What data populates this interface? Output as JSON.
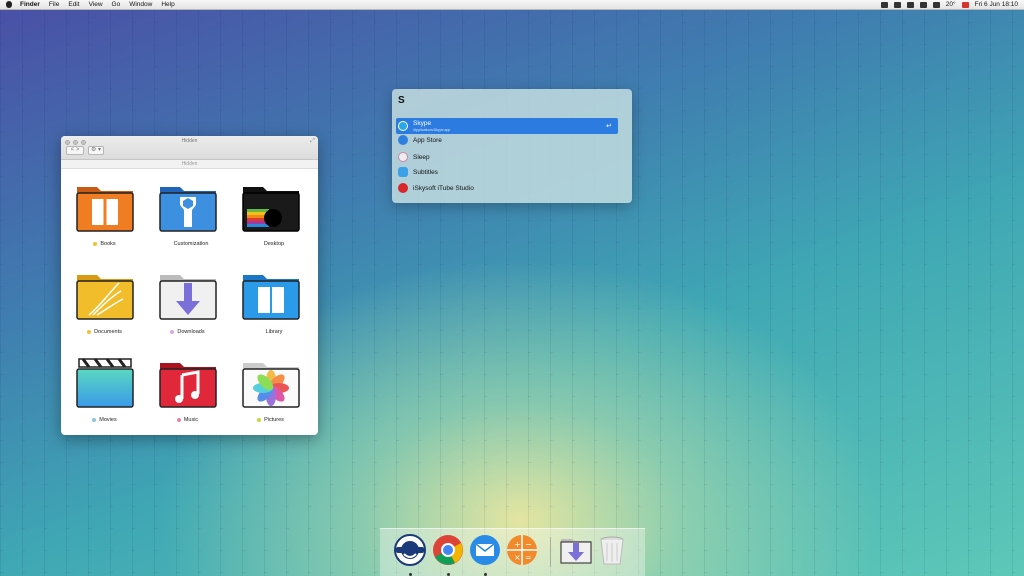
{
  "menubar": {
    "app_name": "Finder",
    "items": [
      "File",
      "Edit",
      "View",
      "Go",
      "Window",
      "Help"
    ],
    "temperature": "20°",
    "datetime": "Fri 6 Jun  18:10"
  },
  "finder": {
    "window_title": "Hidden",
    "path_title": "Hidden",
    "back_label": "<",
    "forward_label": ">",
    "action_label": "⚙ ▾",
    "folders": [
      {
        "label": "Books",
        "tag_color": "#f1c232"
      },
      {
        "label": "Customization",
        "tag_color": "#ffffff"
      },
      {
        "label": "Desktop",
        "tag_color": "#ffffff"
      },
      {
        "label": "Documents",
        "tag_color": "#f1c232"
      },
      {
        "label": "Downloads",
        "tag_color": "#d9a6e8"
      },
      {
        "label": "Library",
        "tag_color": "#ffffff"
      },
      {
        "label": "Movies",
        "tag_color": "#8ec7d8"
      },
      {
        "label": "Music",
        "tag_color": "#e8839a"
      },
      {
        "label": "Pictures",
        "tag_color": "#c8d838"
      }
    ]
  },
  "spotlight": {
    "query": "S",
    "results": [
      {
        "label": "Skype",
        "subtitle": "/Applications/Skype.app",
        "icon": "skype-icon",
        "color": "#2aa8e8",
        "selected": true,
        "enter": "↵"
      },
      {
        "label": "App Store",
        "icon": "app-store-icon",
        "color": "#2f7fe0"
      },
      {
        "label": "Sleep",
        "icon": "sleep-icon",
        "color": "#e8e0f0"
      },
      {
        "label": "Subtitles",
        "icon": "subtitles-icon",
        "color": "#3aa0e8"
      },
      {
        "label": "iSkysoft iTube Studio",
        "icon": "itube-icon",
        "color": "#d8262a"
      }
    ]
  },
  "dock": {
    "apps": [
      "laughing-man-icon",
      "chrome-icon",
      "mail-icon",
      "calculator-icon",
      "downloads-stack-icon",
      "trash-icon"
    ]
  }
}
